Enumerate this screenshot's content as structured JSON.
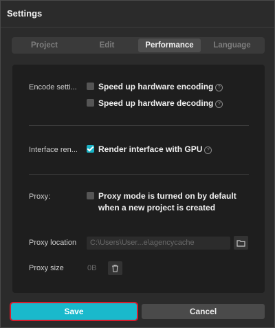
{
  "window": {
    "title": "Settings"
  },
  "tabs": [
    {
      "label": "Project",
      "active": false
    },
    {
      "label": "Edit",
      "active": false
    },
    {
      "label": "Performance",
      "active": true
    },
    {
      "label": "Language",
      "active": false
    }
  ],
  "encode": {
    "label": "Encode setti...",
    "options": [
      {
        "label": "Speed up hardware encoding",
        "checked": false,
        "help_icon": "question-circle-icon"
      },
      {
        "label": "Speed up hardware decoding",
        "checked": false,
        "help_icon": "question-circle-icon"
      }
    ]
  },
  "interface": {
    "label": "Interface ren...",
    "option": {
      "label": "Render interface with GPU",
      "checked": true,
      "help_icon": "question-circle-icon"
    }
  },
  "proxy": {
    "label": "Proxy:",
    "option_label": "Proxy mode is turned on by default when a new project is created",
    "checked": false,
    "location_label": "Proxy location",
    "location_value": "C:\\Users\\User...e\\agencycache",
    "folder_icon": "folder-icon",
    "size_label": "Proxy size",
    "size_value": "0B",
    "delete_icon": "trash-icon"
  },
  "footer": {
    "save_label": "Save",
    "cancel_label": "Cancel"
  },
  "colors": {
    "accent": "#19b9cc",
    "highlight_outline": "#d71c2c"
  }
}
